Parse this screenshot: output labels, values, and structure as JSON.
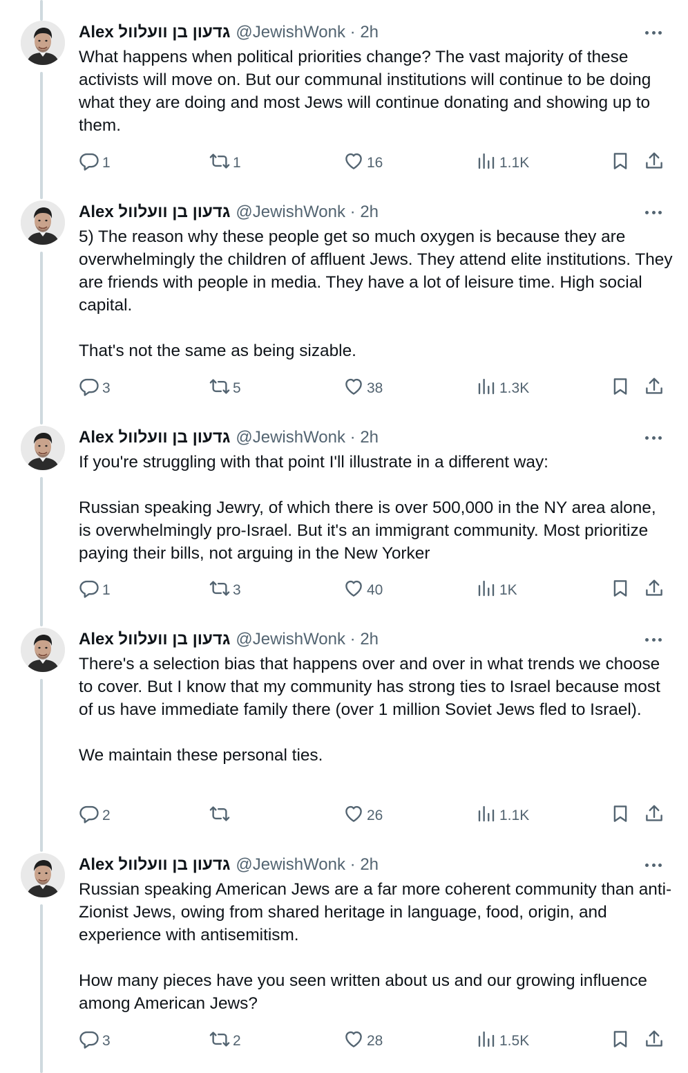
{
  "colors": {
    "text": "#0f1419",
    "secondary": "#536471",
    "thread_line": "#cfd9de"
  },
  "tweets": [
    {
      "name": "Alex גדעון בן וועלוול",
      "handle": "@JewishWonk · 2h",
      "paragraphs": [
        "What happens when political priorities change? The vast majority of these activists will move on. But our communal institutions will continue to be doing what they are doing and most Jews will continue donating and showing up to them."
      ],
      "replies": "1",
      "reposts": "1",
      "likes": "16",
      "views": "1.1K"
    },
    {
      "name": "Alex גדעון בן וועלוול",
      "handle": "@JewishWonk · 2h",
      "paragraphs": [
        "5) The reason why these people get so much oxygen is because they are overwhelmingly the children of affluent Jews. They attend elite institutions. They are friends with people in media. They have a lot of leisure time. High social capital.",
        "That's not the same as being sizable."
      ],
      "replies": "3",
      "reposts": "5",
      "likes": "38",
      "views": "1.3K"
    },
    {
      "name": "Alex גדעון בן וועלוול",
      "handle": "@JewishWonk · 2h",
      "paragraphs": [
        "If you're struggling with that point I'll illustrate in a different way:",
        "Russian speaking Jewry, of which there is over 500,000 in the NY area alone, is overwhelmingly pro-Israel. But it's an immigrant community. Most prioritize paying their bills, not arguing in the New Yorker"
      ],
      "replies": "1",
      "reposts": "3",
      "likes": "40",
      "views": "1K"
    },
    {
      "name": "Alex גדעון בן וועלוול",
      "handle": "@JewishWonk · 2h",
      "paragraphs": [
        "There's a selection bias that happens over and over in what trends we choose to cover. But I know that my community has strong ties to Israel because most of us have immediate family there (over 1 million Soviet Jews fled to Israel).",
        "We maintain these personal ties."
      ],
      "replies": "2",
      "reposts": "",
      "likes": "26",
      "views": "1.1K"
    },
    {
      "name": "Alex גדעון בן וועלוול",
      "handle": "@JewishWonk · 2h",
      "paragraphs": [
        "Russian speaking American Jews are a far more coherent community than anti-Zionist Jews, owing from shared heritage in language, food, origin, and experience with antisemitism.",
        "How many pieces have you seen written about us and our growing influence among American Jews?"
      ],
      "replies": "3",
      "reposts": "2",
      "likes": "28",
      "views": "1.5K"
    }
  ]
}
